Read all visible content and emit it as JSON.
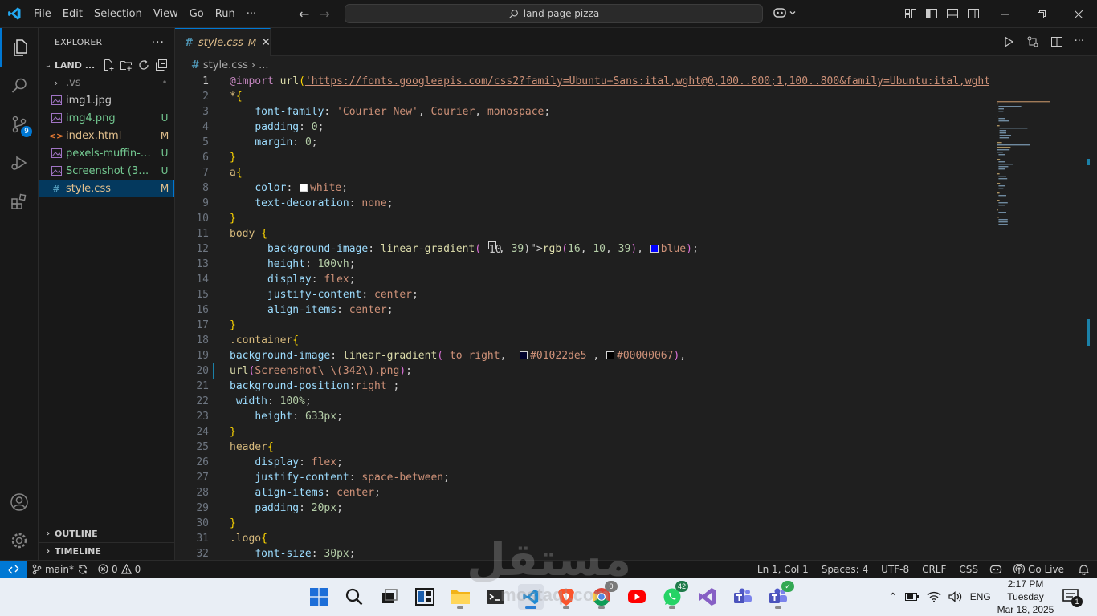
{
  "menu": [
    "File",
    "Edit",
    "Selection",
    "View",
    "Go",
    "Run",
    "···"
  ],
  "command_center": {
    "text": "land page pizza"
  },
  "sidebar": {
    "title": "EXPLORER",
    "more": "···",
    "folder": "LAND ...",
    "files": [
      {
        "name": ".vs",
        "status": "•",
        "kind": "folder"
      },
      {
        "name": "img1.jpg",
        "status": "",
        "kind": "image"
      },
      {
        "name": "img4.png",
        "status": "U",
        "kind": "image"
      },
      {
        "name": "index.html",
        "status": "M",
        "kind": "html"
      },
      {
        "name": "pexels-muffin-2...",
        "status": "U",
        "kind": "image"
      },
      {
        "name": "Screenshot (342)...",
        "status": "U",
        "kind": "image"
      },
      {
        "name": "style.css",
        "status": "M",
        "kind": "css"
      }
    ],
    "outline": "OUTLINE",
    "timeline": "TIMELINE",
    "scm_badge": "9"
  },
  "tab": {
    "name": "style.css",
    "modified": "M",
    "close": "✕"
  },
  "breadcrumb": {
    "file": "style.css",
    "rest": "..."
  },
  "code_lines": [
    "@import url('https://fonts.googleapis.com/css2?family=Ubuntu+Sans:ital,wght@0,100..800;1,100..800&family=Ubuntu:ital,wght@0",
    "*{",
    "    font-family: 'Courier New', Courier, monospace;",
    "    padding: 0;",
    "    margin: 0;",
    "}",
    "a{",
    "    color: white;",
    "    text-decoration: none;",
    "}",
    "body {",
    "      background-image: linear-gradient( rgb(16, 10, 39), blue);",
    "      height: 100vh;",
    "      display: flex;",
    "      justify-content: center;",
    "      align-items: center;",
    "}",
    ".container{",
    "background-image: linear-gradient( to right,  #01022de5 , #00000067),",
    "url(Screenshot\\ \\(342\\).png);",
    "background-position:right ;",
    " width: 100%;",
    "    height: 633px;",
    "}",
    "header{",
    "    display: flex;",
    "    justify-content: space-between;",
    "    align-items: center;",
    "    padding: 20px;",
    "}",
    ".logo{",
    "    font-size: 30px;"
  ],
  "statusbar": {
    "branch": "main*",
    "errors": "0",
    "warnings": "0",
    "position": "Ln 1, Col 1",
    "spaces": "Spaces: 4",
    "encoding": "UTF-8",
    "eol": "CRLF",
    "language": "CSS",
    "golive": "Go Live"
  },
  "taskbar": {
    "chrome_badge": "0",
    "whatsapp_badge": "42",
    "lang": "ENG",
    "time": "2:17 PM",
    "day": "Tuesday",
    "date": "Mar 18, 2025",
    "notif": "1"
  },
  "watermark": {
    "text": "مستقل",
    "sub": "mostaql.com"
  },
  "colors": {
    "accent": "#0078d4",
    "modified": "#e2c08d",
    "untracked": "#73c991",
    "css_icon": "#519aba"
  }
}
